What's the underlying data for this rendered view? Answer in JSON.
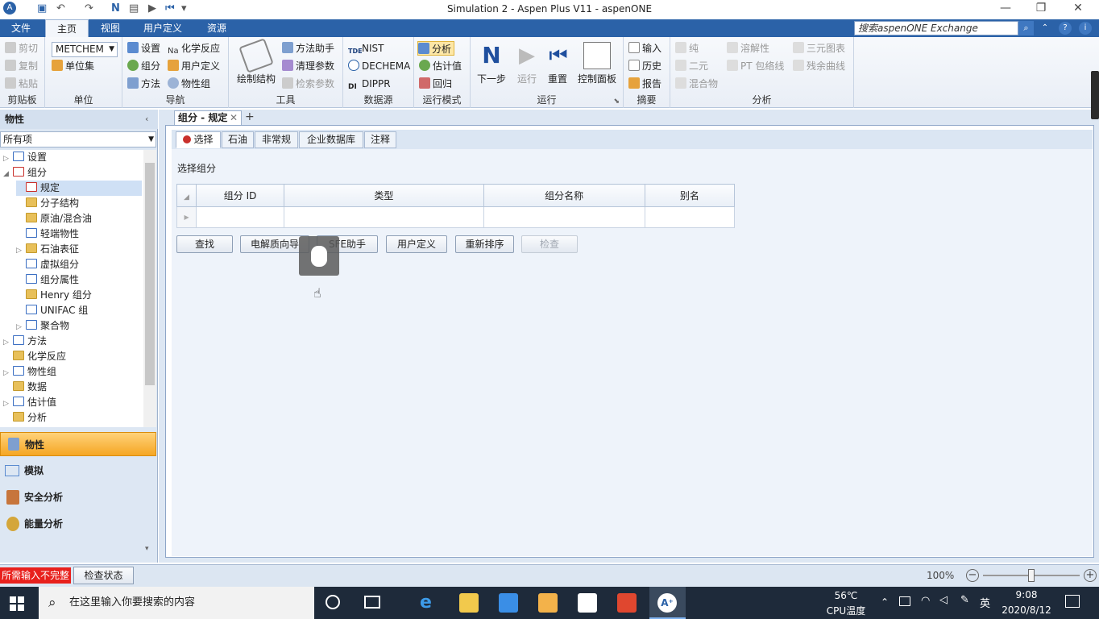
{
  "window": {
    "title": "Simulation 2 - Aspen Plus V11 - aspenONE",
    "controls": {
      "minimize": "—",
      "restore": "❐",
      "close": "✕"
    }
  },
  "ribbon_tabs": [
    "文件",
    "主页",
    "视图",
    "用户定义",
    "资源"
  ],
  "active_ribbon_tab": "主页",
  "search": {
    "placeholder": "搜索aspenONE Exchange"
  },
  "ribbon": {
    "clipboard": {
      "label": "剪贴板",
      "cut": "剪切",
      "copy": "复制",
      "paste": "粘贴"
    },
    "units": {
      "label": "单位",
      "selected": "METCHEM",
      "unit_sets": "单位集"
    },
    "navigation": {
      "label": "导航",
      "setup": "设置",
      "components": "组分",
      "methods": "方法",
      "chem": "化学反应",
      "user_defined": "用户定义",
      "prop_sets": "物性组"
    },
    "tools": {
      "label": "工具",
      "draw_structure": "绘制结构",
      "method_assistant": "方法助手",
      "clean_params": "清理参数",
      "retrieve_params": "检索参数"
    },
    "data_source": {
      "label": "数据源",
      "nist": "NIST",
      "dechema": "DECHEMA",
      "dippr": "DIPPR"
    },
    "run_mode": {
      "label": "运行模式",
      "analysis": "分析",
      "estimation": "估计值",
      "regression": "回归"
    },
    "run": {
      "label": "运行",
      "next": "下一步",
      "run": "运行",
      "reset": "重置",
      "control_panel": "控制面板"
    },
    "summary": {
      "label": "摘要",
      "input": "输入",
      "history": "历史",
      "report": "报告"
    },
    "analysis": {
      "label": "分析",
      "pure": "纯",
      "binary": "二元",
      "mixture": "混合物",
      "solubility": "溶解性",
      "pt_envelope": "PT 包络线",
      "ternary": "三元图表",
      "residue": "残余曲线"
    }
  },
  "left_panel": {
    "header": "物性",
    "filter": "所有项",
    "tree": [
      {
        "label": "设置",
        "level": 0,
        "icon": "check"
      },
      {
        "label": "组分",
        "level": 0,
        "icon": "red"
      },
      {
        "label": "规定",
        "level": 1,
        "icon": "red"
      },
      {
        "label": "分子结构",
        "level": 1,
        "icon": "folder"
      },
      {
        "label": "原油/混合油",
        "level": 1,
        "icon": "folder"
      },
      {
        "label": "轻端物性",
        "level": 1,
        "icon": "check"
      },
      {
        "label": "石油表征",
        "level": 1,
        "icon": "folder"
      },
      {
        "label": "虚拟组分",
        "level": 1,
        "icon": "circle"
      },
      {
        "label": "组分属性",
        "level": 1,
        "icon": "check"
      },
      {
        "label": "Henry 组分",
        "level": 1,
        "icon": "folder"
      },
      {
        "label": "UNIFAC 组",
        "level": 1,
        "icon": "check"
      },
      {
        "label": "聚合物",
        "level": 1,
        "icon": "check"
      },
      {
        "label": "方法",
        "level": 0,
        "icon": "check"
      },
      {
        "label": "化学反应",
        "level": 0,
        "icon": "folder"
      },
      {
        "label": "物性组",
        "level": 0,
        "icon": "check"
      },
      {
        "label": "数据",
        "level": 0,
        "icon": "folder"
      },
      {
        "label": "估计值",
        "level": 0,
        "icon": "check"
      },
      {
        "label": "分析",
        "level": 0,
        "icon": "folder"
      }
    ],
    "nav_buttons": [
      "物性",
      "模拟",
      "安全分析",
      "能量分析"
    ]
  },
  "document": {
    "tab_title": "组分 - 规定",
    "sub_tabs": [
      "选择",
      "石油",
      "非常规",
      "企业数据库",
      "注释"
    ],
    "section_label": "选择组分",
    "table": {
      "headers": [
        "组分 ID",
        "类型",
        "组分名称",
        "别名"
      ]
    },
    "buttons": [
      "查找",
      "电解质向导",
      "SFE助手",
      "用户定义",
      "重新排序",
      "检查"
    ]
  },
  "status": {
    "warning": "所需输入不完整",
    "check_status": "检查状态",
    "zoom": "100%",
    "zoom_level": 0.5
  },
  "taskbar": {
    "search_placeholder": "在这里输入你要搜索的内容",
    "temp": "56℃",
    "temp_label": "CPU温度",
    "ime": "英",
    "time": "9:08",
    "date": "2020/8/12"
  },
  "colors": {
    "ribbon_blue": "#2b62a8",
    "accent_orange": "#f5a623",
    "warning_red": "#e8201c"
  }
}
